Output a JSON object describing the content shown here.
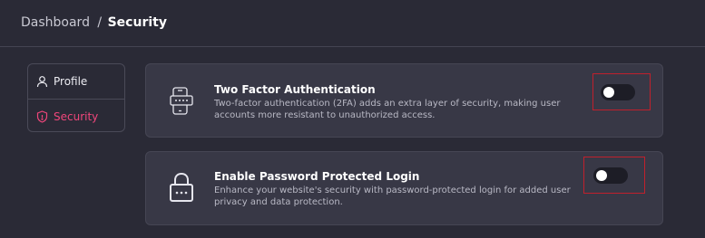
{
  "breadcrumb": {
    "root": "Dashboard",
    "separator": "/",
    "current": "Security"
  },
  "sidebar": {
    "items": [
      {
        "label": "Profile",
        "icon": "user-icon",
        "active": false
      },
      {
        "label": "Security",
        "icon": "shield-icon",
        "active": true
      }
    ]
  },
  "settings": [
    {
      "icon": "phone-chat-icon",
      "title": "Two Factor Authentication",
      "description": "Two-factor authentication (2FA) adds an extra layer of security, making user accounts more resistant to unauthorized access.",
      "enabled": false
    },
    {
      "icon": "padlock-icon",
      "title": "Enable Password Protected Login",
      "description": "Enhance your website's security with password-protected login for added user privacy and data protection.",
      "enabled": false
    }
  ],
  "colors": {
    "background": "#2a2a36",
    "card": "#383846",
    "accent": "#f0467b",
    "highlight_border": "#c0202c"
  }
}
